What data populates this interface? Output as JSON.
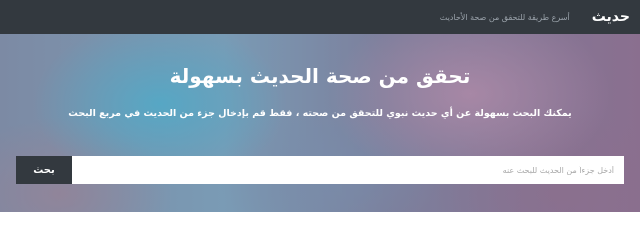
{
  "navbar": {
    "brand": "حديث",
    "tagline": "أسرع طريقة للتحقق من صحة الأحاديث"
  },
  "hero": {
    "title": "تحقق من صحة الحديث بسهولة",
    "subtitle": "يمكنك البحث بسهولة عن أي حديث نبوي للتحقق من صحته ، فقط قم بإدخال جزء من الحديث في مربع البحث"
  },
  "search": {
    "value": "",
    "placeholder": "أدخل جزءاً من الحديث للبحث عنه",
    "button_label": "بحث"
  },
  "colors": {
    "navbar_bg": "#33393f",
    "button_bg": "#33393f",
    "hero_text": "#ffffff"
  }
}
